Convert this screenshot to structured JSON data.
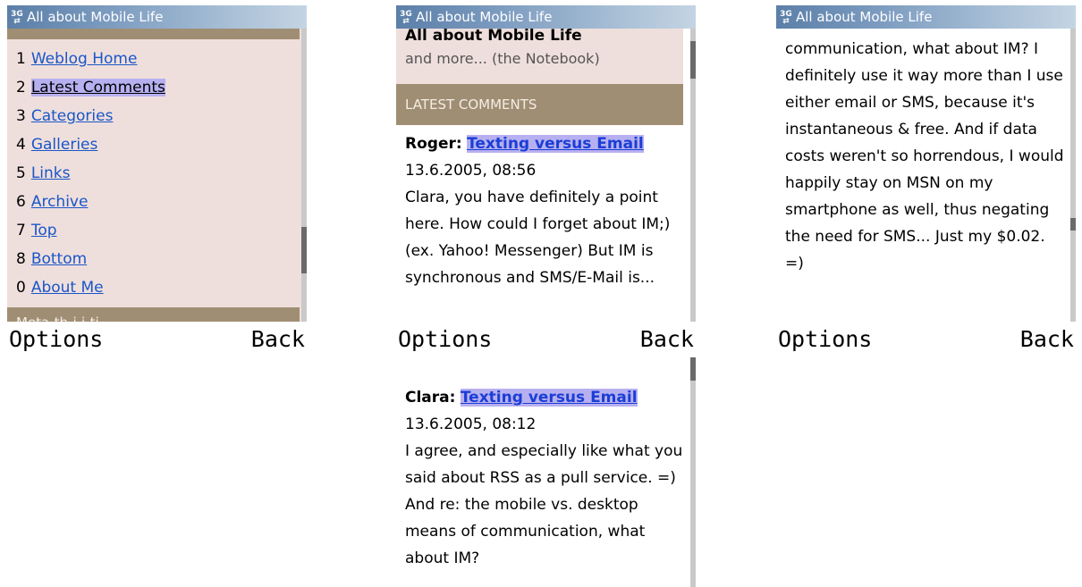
{
  "app_title": "All about Mobile Life",
  "network_indicator": [
    "3G",
    "⇄"
  ],
  "softkeys": {
    "left": "Options",
    "right": "Back"
  },
  "menu_screen": {
    "items": [
      {
        "num": "1",
        "label": "Weblog Home"
      },
      {
        "num": "2",
        "label": "Latest Comments",
        "selected": true
      },
      {
        "num": "3",
        "label": "Categories"
      },
      {
        "num": "4",
        "label": "Galleries"
      },
      {
        "num": "5",
        "label": "Links"
      },
      {
        "num": "6",
        "label": "Archive"
      },
      {
        "num": "7",
        "label": "Top"
      },
      {
        "num": "8",
        "label": "Bottom"
      },
      {
        "num": "0",
        "label": "About Me"
      }
    ],
    "cutoff_text": "Meta-th-i-i-ti-"
  },
  "comments_screen": {
    "blog_title": "All about Mobile Life",
    "blog_subtitle": "and more... (the Notebook)",
    "section_title": "LATEST COMMENTS",
    "comments": [
      {
        "author": "Roger:",
        "post_title": "Texting versus Email",
        "date": "13.6.2005, 08:56",
        "body": "Clara, you have definitely a point here. How could I forget about IM;) (ex. Yahoo! Messenger) But IM is synchronous and SMS/E-Mail is..."
      },
      {
        "author": "Clara:",
        "post_title": "Texting versus Email",
        "date": "13.6.2005, 08:12",
        "body": "I agree, and especially like what you said about RSS as a pull service. =) And re: the mobile vs. desktop means of communication, what about IM?"
      }
    ]
  },
  "comment_detail_screen": {
    "body": "communication, what about IM? I definitely use it way more than I use either email or SMS, because it's instantaneous & free. And if data costs weren't so horrendous, I would happily stay on MSN on my smartphone as well, thus negating the need for SMS... Just my $0.02. =)"
  }
}
